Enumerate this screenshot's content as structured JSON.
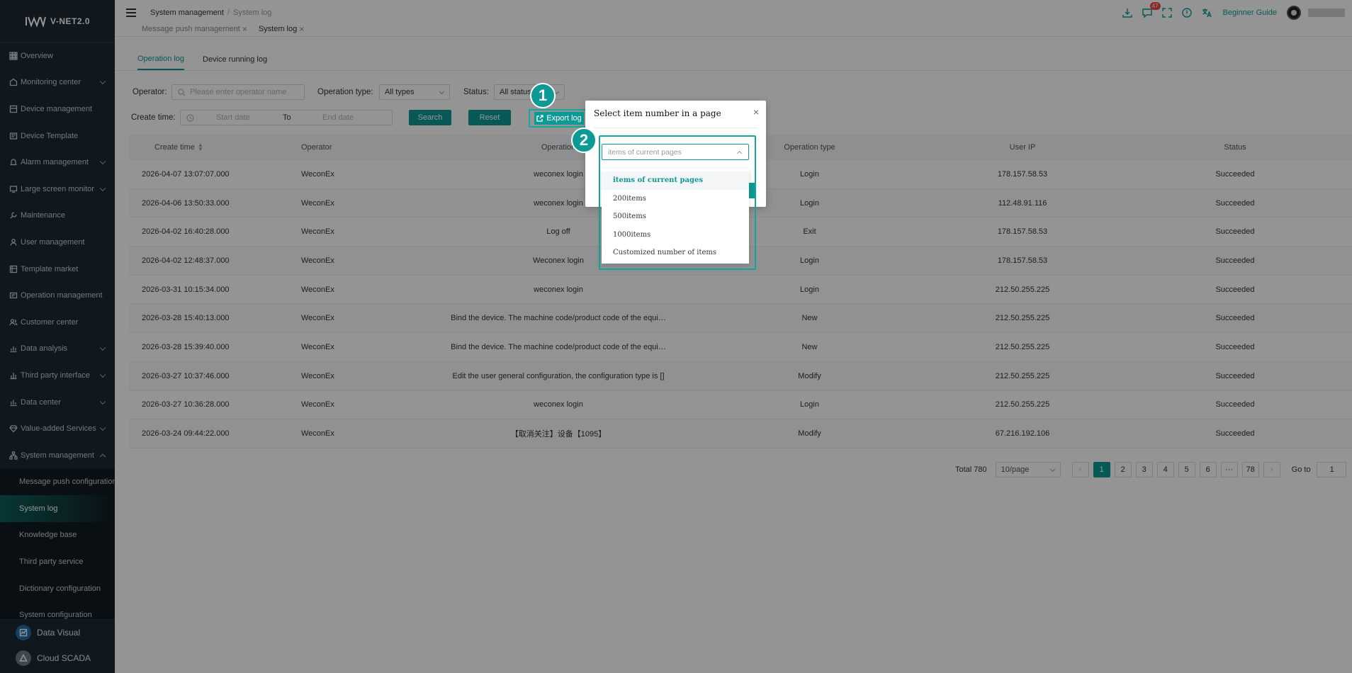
{
  "app": {
    "logo_text": "V-NET2.0"
  },
  "sidebar": {
    "items": [
      {
        "label": "Overview",
        "icon": "grid-icon",
        "chevron": false
      },
      {
        "label": "Monitoring center",
        "icon": "monitor-center-icon",
        "chevron": true
      },
      {
        "label": "Device management",
        "icon": "device-icon",
        "chevron": false
      },
      {
        "label": "Device Template",
        "icon": "template-icon",
        "chevron": false
      },
      {
        "label": "Alarm management",
        "icon": "alarm-icon",
        "chevron": true
      },
      {
        "label": "Large screen monitor",
        "icon": "screen-icon",
        "chevron": true
      },
      {
        "label": "Maintenance",
        "icon": "maintenance-icon",
        "chevron": false
      },
      {
        "label": "User management",
        "icon": "user-icon",
        "chevron": false
      },
      {
        "label": "Template market",
        "icon": "market-icon",
        "chevron": false
      },
      {
        "label": "Operation management",
        "icon": "operation-icon",
        "chevron": false
      },
      {
        "label": "Customer center",
        "icon": "customer-icon",
        "chevron": false
      },
      {
        "label": "Data analysis",
        "icon": "analysis-icon",
        "chevron": true
      },
      {
        "label": "Third party interface",
        "icon": "interface-icon",
        "chevron": true
      },
      {
        "label": "Data center",
        "icon": "datacenter-icon",
        "chevron": true
      },
      {
        "label": "Value-added Services",
        "icon": "diamond-icon",
        "chevron": true
      },
      {
        "label": "System management",
        "icon": "system-icon",
        "chevron": true
      }
    ],
    "submenu": [
      {
        "label": "Message push configuration"
      },
      {
        "label": "System log"
      },
      {
        "label": "Knowledge base"
      },
      {
        "label": "Third party service"
      },
      {
        "label": "Dictionary configuration"
      },
      {
        "label": "System configuration"
      }
    ],
    "bottom": [
      {
        "label": "Data Visual"
      },
      {
        "label": "Cloud SCADA"
      }
    ]
  },
  "header": {
    "breadcrumb": [
      "System management",
      "System log"
    ],
    "tabs": [
      {
        "label": "Message push management"
      },
      {
        "label": "System log"
      }
    ],
    "badge_count": "47",
    "guide_label": "Beginner Guide"
  },
  "page": {
    "sub_tabs": [
      "Operation log",
      "Device running log"
    ],
    "filters": {
      "operator_label": "Operator:",
      "operator_placeholder": "Please enter operator name",
      "type_label": "Operation type:",
      "type_value": "All types",
      "status_label": "Status:",
      "status_value": "All status",
      "time_label": "Create time:",
      "start_placeholder": "Start date",
      "to_label": "To",
      "end_placeholder": "End date"
    },
    "buttons": {
      "search": "Search",
      "reset": "Reset",
      "export": "Export log"
    }
  },
  "table": {
    "headers": [
      "Create time",
      "Operator",
      "Operation",
      "Operation type",
      "User IP",
      "Status"
    ],
    "rows": [
      [
        "2026-04-07 13:07:07.000",
        "WeconEx",
        "weconex login",
        "Login",
        "178.157.58.53",
        "Succeeded"
      ],
      [
        "2026-04-06 13:50:33.000",
        "WeconEx",
        "weconex login",
        "Login",
        "112.48.91.116",
        "Succeeded"
      ],
      [
        "2026-04-02 16:40:28.000",
        "WeconEx",
        "Log off",
        "Exit",
        "178.157.58.53",
        "Succeeded"
      ],
      [
        "2026-04-02 12:48:37.000",
        "WeconEx",
        "Weconex login",
        "Login",
        "178.157.58.53",
        "Succeeded"
      ],
      [
        "2026-03-31 10:15:34.000",
        "WeconEx",
        "weconex login",
        "Login",
        "212.50.255.225",
        "Succeeded"
      ],
      [
        "2026-03-28 15:40:13.000",
        "WeconEx",
        "Bind the device. The machine code/product code of the equi…",
        "New",
        "212.50.255.225",
        "Succeeded"
      ],
      [
        "2026-03-28 15:39:40.000",
        "WeconEx",
        "Bind the device. The machine code/product code of the equi…",
        "New",
        "212.50.255.225",
        "Succeeded"
      ],
      [
        "2026-03-27 10:37:46.000",
        "WeconEx",
        "Edit the user general configuration, the configuration type is []",
        "Modify",
        "212.50.255.225",
        "Succeeded"
      ],
      [
        "2026-03-27 10:36:28.000",
        "WeconEx",
        "weconex login",
        "Login",
        "212.50.255.225",
        "Succeeded"
      ],
      [
        "2026-03-24 09:44:22.000",
        "WeconEx",
        "【取消关注】设备【1095】",
        "Modify",
        "67.216.192.106",
        "Succeeded"
      ]
    ]
  },
  "pagination": {
    "total": "Total 780",
    "page_size": "10/page",
    "pages": [
      "1",
      "2",
      "3",
      "4",
      "5",
      "6",
      "···",
      "78"
    ],
    "current": "1",
    "goto_label": "Go to",
    "goto_value": "1"
  },
  "dialog": {
    "title": "Select item number in a page",
    "select_placeholder": "items of current pages",
    "options": [
      "items of current pages",
      "200items",
      "500items",
      "1000items",
      "Customized number of items"
    ],
    "selected_option": "items of current pages"
  },
  "steps": [
    "1",
    "2"
  ],
  "colors": {
    "accent": "#0e9a94",
    "sidebar_bg": "#1c2833"
  }
}
